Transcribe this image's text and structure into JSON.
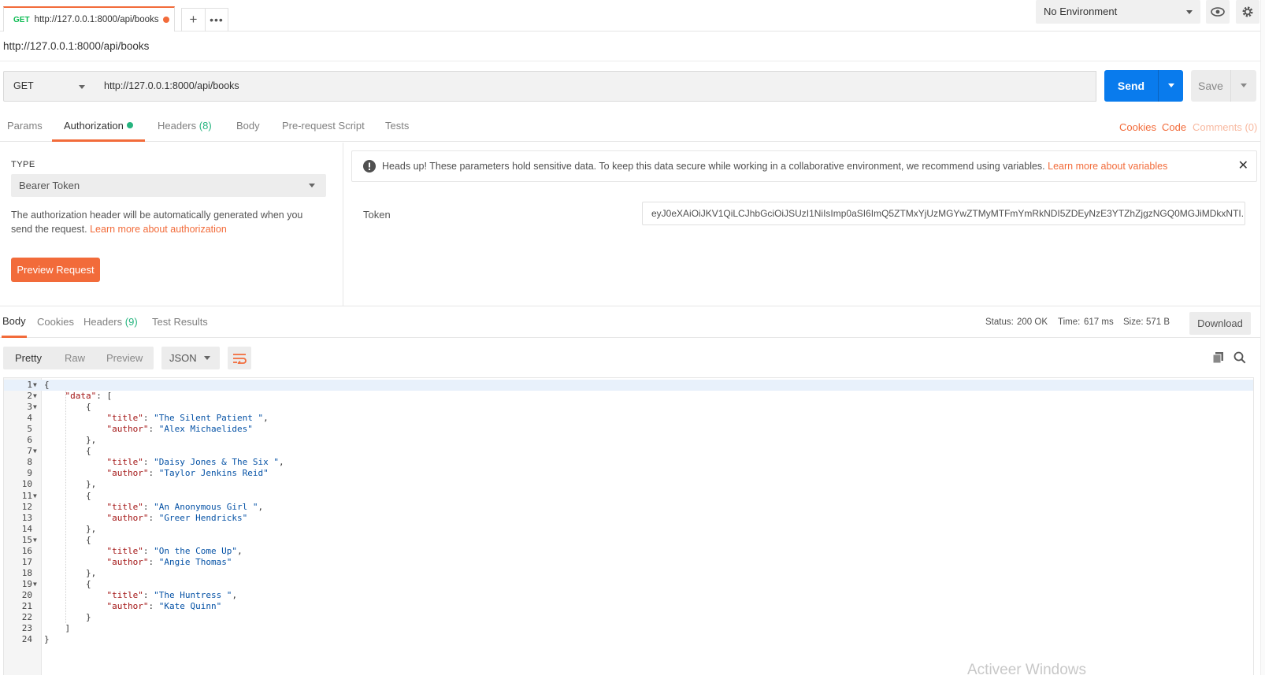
{
  "tab": {
    "method": "GET",
    "name": "http://127.0.0.1:8000/api/books"
  },
  "environment": {
    "selected": "No Environment"
  },
  "request_name": "http://127.0.0.1:8000/api/books",
  "request": {
    "method": "GET",
    "url": "http://127.0.0.1:8000/api/books",
    "send_label": "Send",
    "save_label": "Save"
  },
  "request_tabs": {
    "params": "Params",
    "authorization": "Authorization",
    "headers": "Headers",
    "headers_count": "(8)",
    "body": "Body",
    "prerequest": "Pre-request Script",
    "tests": "Tests",
    "cookies": "Cookies",
    "code": "Code",
    "comments": "Comments (0)"
  },
  "auth": {
    "type_label": "TYPE",
    "type_value": "Bearer Token",
    "help_text": "The authorization header will be automatically generated when you send the request.",
    "help_link": "Learn more about authorization",
    "preview_button": "Preview Request",
    "notice_text": "Heads up! These parameters hold sensitive data. To keep this data secure while working in a collaborative environment, we recommend using variables.",
    "notice_link": "Learn more about variables",
    "token_label": "Token",
    "token_value": "eyJ0eXAiOiJKV1QiLCJhbGciOiJSUzI1NiIsImp0aSI6ImQ5ZTMxYjUzMGYwZTMyMTFmYmRkNDI5ZDEyNzE3YTZhZjgzNGQ0MGJiMDkxNTI..."
  },
  "response": {
    "tabs": {
      "body": "Body",
      "cookies": "Cookies",
      "headers": "Headers",
      "headers_count": "(9)",
      "test_results": "Test Results"
    },
    "status_label": "Status:",
    "status_value": "200 OK",
    "time_label": "Time:",
    "time_value": "617 ms",
    "size_label": "Size:",
    "size_value": "571 B",
    "download": "Download",
    "views": {
      "pretty": "Pretty",
      "raw": "Raw",
      "preview": "Preview"
    },
    "format": "JSON"
  },
  "json_body": {
    "data": [
      {
        "title": "The Silent Patient ",
        "author": "Alex Michaelides"
      },
      {
        "title": "Daisy Jones & The Six ",
        "author": "Taylor Jenkins Reid"
      },
      {
        "title": "An Anonymous Girl ",
        "author": "Greer Hendricks"
      },
      {
        "title": "On the Come Up",
        "author": "Angie Thomas"
      },
      {
        "title": "The Huntress ",
        "author": "Kate Quinn"
      }
    ]
  },
  "line_count": 24,
  "watermark": "Activeer Windows",
  "colors": {
    "accent": "#f26b3a",
    "send": "#097bed",
    "success": "#26b47f",
    "method_get": "#0cbb52"
  }
}
